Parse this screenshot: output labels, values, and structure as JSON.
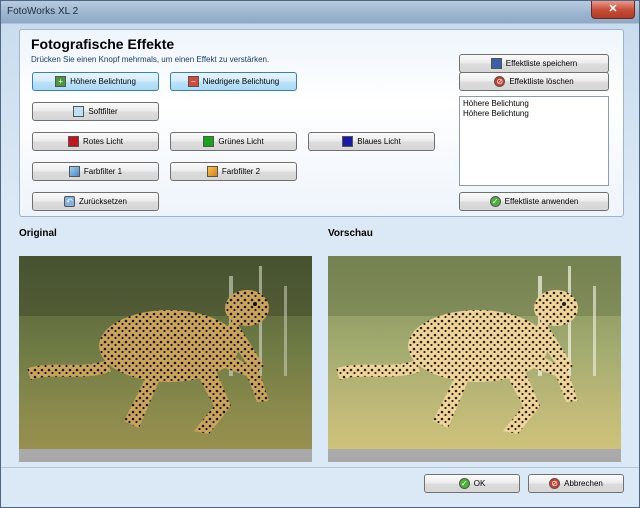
{
  "window": {
    "title": "FotoWorks XL 2",
    "close_glyph": "✕"
  },
  "effects": {
    "heading": "Fotografische Effekte",
    "subtitle": "Drücken Sie einen Knopf mehrmals, um einen Effekt zu verstärken.",
    "buttons": {
      "higher_exposure": "Höhere Belichtung",
      "lower_exposure": "Niedrigere Belichtung",
      "soft_filter": "Softfilter",
      "red_light": "Rotes Licht",
      "green_light": "Grünes Licht",
      "blue_light": "Blaues Licht",
      "color_filter_1": "Farbfilter 1",
      "color_filter_2": "Farbfilter 2",
      "reset": "Zurücksetzen"
    }
  },
  "effect_list": {
    "save_label": "Effektliste speichern",
    "delete_label": "Effektliste löschen",
    "apply_label": "Effektliste anwenden",
    "items": [
      "Höhere Belichtung",
      "Höhere Belichtung"
    ]
  },
  "preview": {
    "original_label": "Original",
    "preview_label": "Vorschau"
  },
  "footer": {
    "ok_label": "OK",
    "cancel_label": "Abbrechen"
  },
  "colors": {
    "red_swatch": "#c0161c",
    "green_swatch": "#1aa31a",
    "blue_swatch": "#1a1aa8",
    "accent_pressed": "#3c7fb1"
  }
}
